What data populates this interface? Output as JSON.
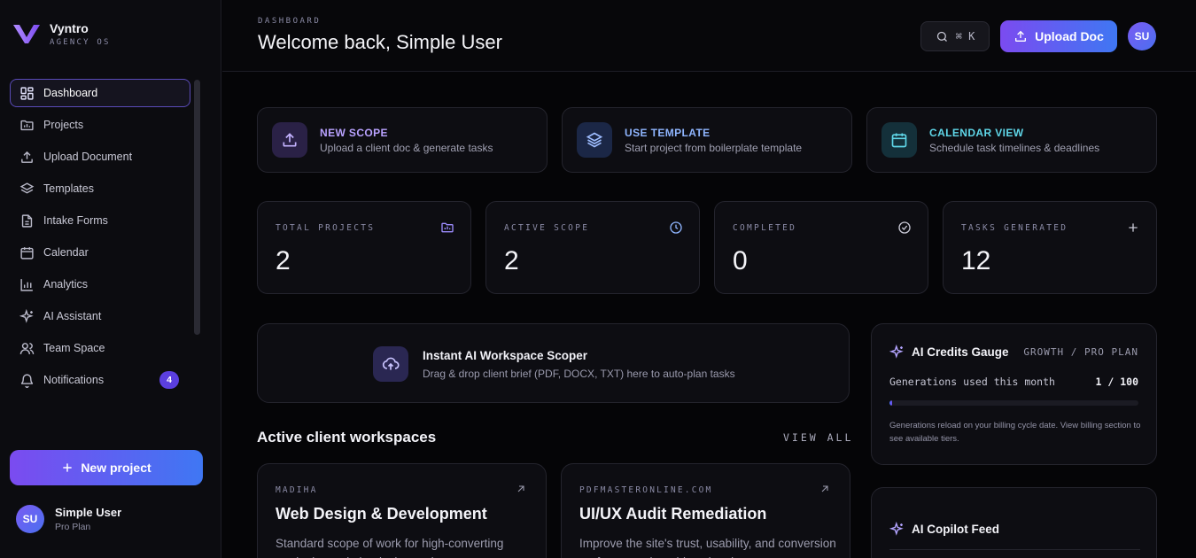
{
  "brand": {
    "name": "Vyntro",
    "subtitle": "AGENCY OS"
  },
  "sidebar": {
    "items": [
      {
        "label": "Dashboard",
        "icon": "grid-icon",
        "active": true
      },
      {
        "label": "Projects",
        "icon": "folder-icon"
      },
      {
        "label": "Upload Document",
        "icon": "upload-icon"
      },
      {
        "label": "Templates",
        "icon": "layers-icon"
      },
      {
        "label": "Intake Forms",
        "icon": "file-icon"
      },
      {
        "label": "Calendar",
        "icon": "calendar-icon"
      },
      {
        "label": "Analytics",
        "icon": "bar-chart-icon"
      },
      {
        "label": "AI Assistant",
        "icon": "sparkle-icon"
      },
      {
        "label": "Team Space",
        "icon": "users-icon"
      },
      {
        "label": "Notifications",
        "icon": "bell-icon",
        "badge": "4"
      }
    ],
    "new_project_label": "New project",
    "user": {
      "initials": "SU",
      "name": "Simple User",
      "plan": "Pro Plan"
    }
  },
  "header": {
    "breadcrumb": "DASHBOARD",
    "title": "Welcome back, Simple User",
    "shortcut": "⌘ K",
    "upload_label": "Upload Doc",
    "avatar_initials": "SU"
  },
  "actions": [
    {
      "title": "NEW SCOPE",
      "desc": "Upload a client doc & generate tasks",
      "icon": "upload-icon",
      "color": "#b9a2ff",
      "bg": "#2a2146"
    },
    {
      "title": "USE TEMPLATE",
      "desc": "Start project from boilerplate template",
      "icon": "layers-icon",
      "color": "#8fb5ff",
      "bg": "#1b2746"
    },
    {
      "title": "CALENDAR VIEW",
      "desc": "Schedule task timelines & deadlines",
      "icon": "calendar-icon",
      "color": "#5fd6e8",
      "bg": "#14303a"
    }
  ],
  "stats": [
    {
      "label": "TOTAL PROJECTS",
      "value": "2",
      "icon": "folder-chart-icon",
      "color": "#9d8cff"
    },
    {
      "label": "ACTIVE SCOPE",
      "value": "2",
      "icon": "clock-icon",
      "color": "#8fb5ff"
    },
    {
      "label": "COMPLETED",
      "value": "0",
      "icon": "check-circle-icon",
      "color": "#c9c9d6"
    },
    {
      "label": "TASKS GENERATED",
      "value": "12",
      "icon": "plus-icon",
      "color": "#c9c9d6"
    }
  ],
  "dropzone": {
    "title": "Instant AI Workspace Scoper",
    "desc": "Drag & drop client brief (PDF, DOCX, TXT) here to auto-plan tasks"
  },
  "workspaces": {
    "title": "Active client workspaces",
    "view_all": "VIEW ALL",
    "items": [
      {
        "client": "MADIHA",
        "title": "Web Design & Development",
        "desc": "Standard scope of work for high-converting marketing website design and custom"
      },
      {
        "client": "PDFMASTERONLINE.COM",
        "title": "UI/UX Audit Remediation",
        "desc": "Improve the site's trust, usability, and conversion performance by addressing the"
      }
    ]
  },
  "credits": {
    "title": "AI Credits Gauge",
    "plan": "GROWTH / PRO PLAN",
    "used_label": "Generations used this month",
    "count": "1 / 100",
    "used_fraction": 0.01,
    "note": "Generations reload on your billing cycle date. View billing section to see available tiers."
  },
  "copilot": {
    "title": "AI Copilot Feed"
  }
}
